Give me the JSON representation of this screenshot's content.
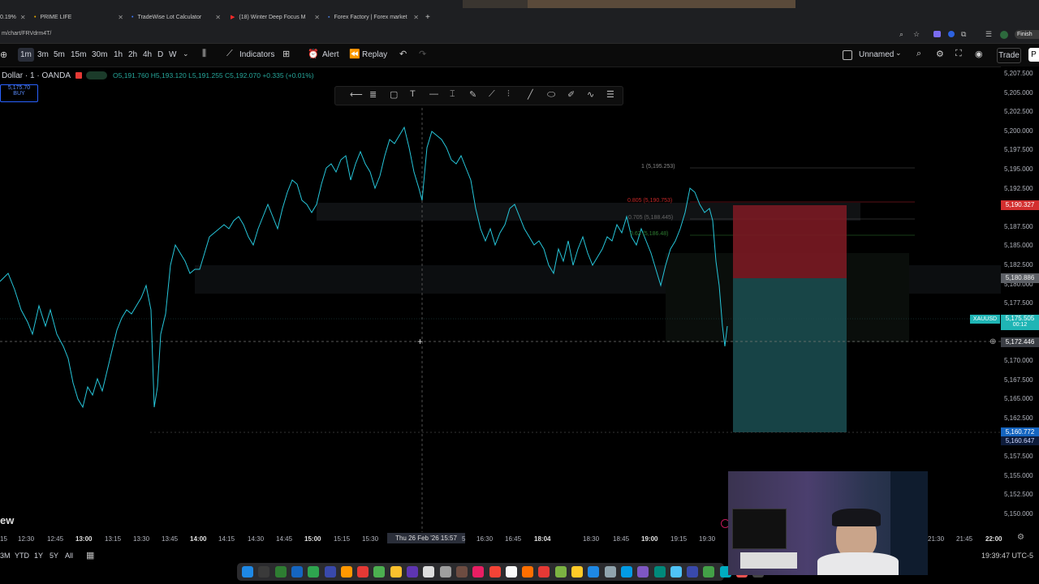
{
  "browser": {
    "tabs": [
      {
        "label": "PRIME LIFE"
      },
      {
        "label": "TradeWise Lot Calculator"
      },
      {
        "label": "(18) Winter Deep Focus M"
      },
      {
        "label": "Forex Factory | Forex market"
      }
    ],
    "first_tab_fragment": "0.19%",
    "new_tab": "+",
    "url": "m/chart/FRVdrm4T/",
    "finish_label": "Finish up"
  },
  "toolbar": {
    "timeframes": [
      "1m",
      "3m",
      "5m",
      "15m",
      "30m",
      "1h",
      "2h",
      "4h",
      "D",
      "W"
    ],
    "indicators_label": "Indicators",
    "alert_label": "Alert",
    "replay_label": "Replay",
    "layout_name": "Unnamed",
    "trade_label": "Trade",
    "publish_fragment": "P"
  },
  "symbol": {
    "name": "Dollar · 1 · OANDA",
    "ohlc": "O5,191.760 H5,193.120 L5,191.255 C5,192.070 +0.335 (+0.01%)",
    "buy_price": "5,175.70",
    "buy_label": "BUY"
  },
  "fib": {
    "lvl1": "1 (5,195.253)",
    "lvl0805": "0.805 (5,190.753)",
    "lvl0705": "0.705 (5,188.445)",
    "lvl062": "0.62 (5,186.48)"
  },
  "price_axis": [
    "5,207.500",
    "5,205.000",
    "5,202.500",
    "5,200.000",
    "5,197.500",
    "5,195.000",
    "5,192.500",
    "5,190.000",
    "5,187.500",
    "5,185.000",
    "5,182.500",
    "5,180.000",
    "5,177.500",
    "5,175.000",
    "5,172.500",
    "5,170.000",
    "5,167.500",
    "5,165.000",
    "5,162.500",
    "5,160.000",
    "5,157.500",
    "5,155.000",
    "5,152.500",
    "5,150.000"
  ],
  "price_tags": {
    "stop": "5,190.327",
    "entry": "5,180.886",
    "ticker": "XAUUSD",
    "current": "5,175.505",
    "countdown": "00:12",
    "cursor": "5,172.446",
    "target1": "5,160.772",
    "target2": "5,160.647"
  },
  "time_axis": [
    "15",
    "12:30",
    "12:45",
    "13:00",
    "13:15",
    "13:30",
    "13:45",
    "14:00",
    "14:15",
    "14:30",
    "14:45",
    "15:00",
    "15:15",
    "15:30",
    "16:30",
    "16:45",
    "18:04",
    "18:30",
    "18:45",
    "19:00",
    "19:15",
    "19:30",
    "21:30",
    "21:45",
    "22:00"
  ],
  "cursor_time": "Thu 26 Feb '26   15:57",
  "cursor_time_suffix": "5",
  "ranges": [
    "3M",
    "YTD",
    "1Y",
    "5Y",
    "All"
  ],
  "clock": "19:39:47 UTC-5",
  "watermark_fragment": "ew",
  "colors": {
    "candle": "#26c6da",
    "loss_zone": "#8b1a22",
    "profit_zone": "#1c5a5a",
    "accent": "#2962ff"
  }
}
